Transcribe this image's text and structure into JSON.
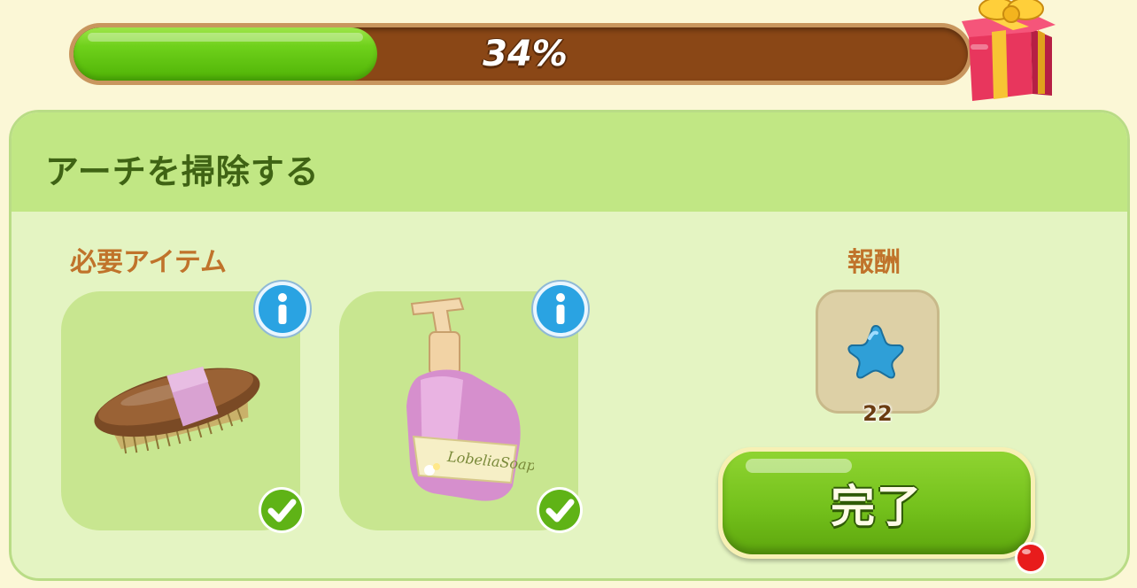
{
  "progress": {
    "percent_text": "34%",
    "value": 0.34,
    "fill_color": "#6fd11b",
    "track_color": "#8a4716"
  },
  "task": {
    "title": "アーチを掃除する"
  },
  "required_items": {
    "label": "必要アイテム",
    "items": [
      {
        "name": "brush",
        "icon": "brush-icon",
        "status": "collected"
      },
      {
        "name": "soap",
        "icon": "soap-bottle-icon",
        "label_text": "LobeliaSoap",
        "status": "collected"
      }
    ]
  },
  "reward": {
    "label": "報酬",
    "icon": "blue-star-icon",
    "count": "22"
  },
  "complete_button": {
    "label": "完了",
    "has_notification": true
  },
  "colors": {
    "panel_bg": "#e4f4c2",
    "header_bg": "#c1e784",
    "title_text": "#3f6314",
    "label_text": "#c0732b",
    "button_green": "#74c11c"
  }
}
